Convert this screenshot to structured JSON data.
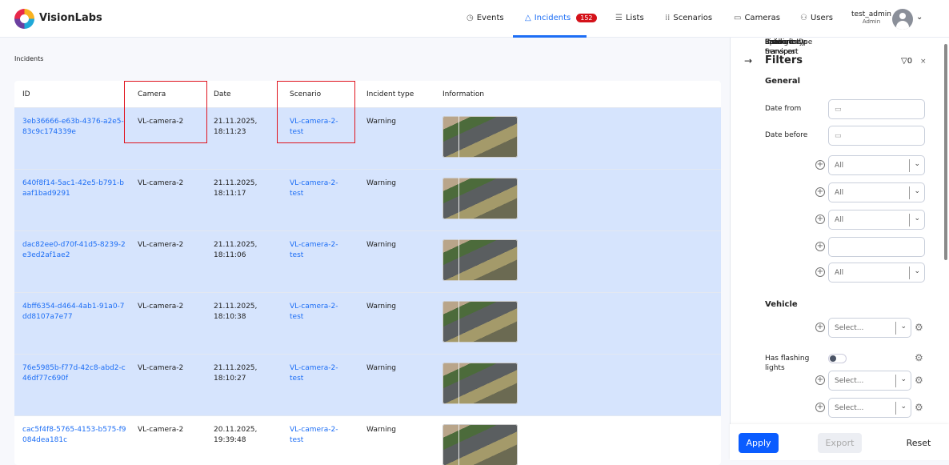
{
  "app": {
    "brand": "VisionLabs"
  },
  "nav": [
    {
      "label": "Events",
      "icon": "◷"
    },
    {
      "label": "Incidents",
      "icon": "△",
      "badge": "152"
    },
    {
      "label": "Lists",
      "icon": "☰"
    },
    {
      "label": "Scenarios",
      "icon": "⁞⁞"
    },
    {
      "label": "Cameras",
      "icon": "▭"
    },
    {
      "label": "Users",
      "icon": "⚇"
    }
  ],
  "user": {
    "name": "test_admin",
    "role": "Admin"
  },
  "breadcrumb": "Incidents",
  "table": {
    "headers": [
      "ID",
      "Camera",
      "Date",
      "Scenario",
      "Incident type",
      "Information"
    ],
    "rows": [
      {
        "id": "3eb36666-e63b-4376-a2e5-83c9c174339e",
        "camera": "VL-camera-2",
        "date": "21.11.2025, 18:11:23",
        "scenario": "VL-camera-2-test",
        "type": "Warning",
        "selected": true
      },
      {
        "id": "640f8f14-5ac1-42e5-b791-baaf1bad9291",
        "camera": "VL-camera-2",
        "date": "21.11.2025, 18:11:17",
        "scenario": "VL-camera-2-test",
        "type": "Warning",
        "selected": true
      },
      {
        "id": "dac82ee0-d70f-41d5-8239-2e3ed2af1ae2",
        "camera": "VL-camera-2",
        "date": "21.11.2025, 18:11:06",
        "scenario": "VL-camera-2-test",
        "type": "Warning",
        "selected": true
      },
      {
        "id": "4bff6354-d464-4ab1-91a0-7dd8107a7e77",
        "camera": "VL-camera-2",
        "date": "21.11.2025, 18:10:38",
        "scenario": "VL-camera-2-test",
        "type": "Warning",
        "selected": true
      },
      {
        "id": "76e5985b-f77d-42c8-abd2-c46df77c690f",
        "camera": "VL-camera-2",
        "date": "21.11.2025, 18:10:27",
        "scenario": "VL-camera-2-test",
        "type": "Warning",
        "selected": true
      },
      {
        "id": "cac5f4f8-5765-4153-b575-f9084dea181c",
        "camera": "VL-camera-2",
        "date": "20.11.2025, 19:39:48",
        "scenario": "VL-camera-2-test",
        "type": "Warning",
        "selected": false
      }
    ]
  },
  "filters": {
    "title": "Filters",
    "count": "0",
    "close": "×",
    "general": "General",
    "vehicle": "Vehicle",
    "date_from": "Date from",
    "date_before": "Date before",
    "scenario": {
      "label": "Scenario",
      "value": "All"
    },
    "incident_type": {
      "label": "Incident type",
      "value": "All"
    },
    "cameras": {
      "label": "Cameras",
      "value": "All"
    },
    "incident_ids": {
      "label": "Incident IDs",
      "value": ""
    },
    "lists": {
      "label": "Lists",
      "value": "All"
    },
    "emergency": {
      "label": "Emergency Services",
      "placeholder": "Select..."
    },
    "flashing": {
      "label": "Has flashing lights",
      "on": false
    },
    "special": {
      "label": "Special transport",
      "placeholder": "Select..."
    },
    "public": {
      "label": "Public transport",
      "placeholder": "Select..."
    }
  },
  "footer": {
    "apply": "Apply",
    "export": "Export",
    "reset": "Reset"
  }
}
